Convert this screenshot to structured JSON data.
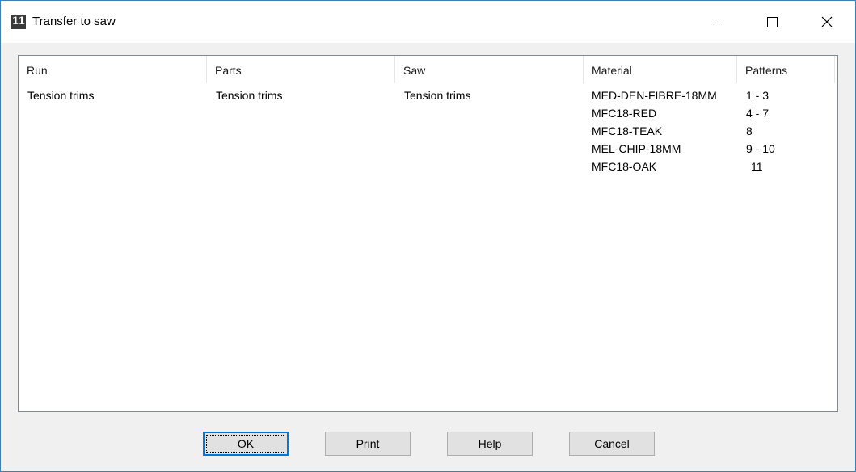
{
  "window": {
    "title": "Transfer to saw",
    "icon": "app-logo-icon",
    "icon_text": "11"
  },
  "columns": [
    "Run",
    "Parts",
    "Saw",
    "Material",
    "Patterns"
  ],
  "rows": [
    {
      "run": "Tension trims",
      "parts": "Tension trims",
      "saw": "Tension trims",
      "material": "MED-DEN-FIBRE-18MM",
      "patterns": "1 - 3"
    },
    {
      "run": "",
      "parts": "",
      "saw": "",
      "material": "MFC18-RED",
      "patterns": "4 - 7"
    },
    {
      "run": "",
      "parts": "",
      "saw": "",
      "material": "MFC18-TEAK",
      "patterns": "8"
    },
    {
      "run": "",
      "parts": "",
      "saw": "",
      "material": "MEL-CHIP-18MM",
      "patterns": "9 - 10"
    },
    {
      "run": "",
      "parts": "",
      "saw": "",
      "material": "MFC18-OAK",
      "patterns": "11"
    }
  ],
  "buttons": {
    "ok": "OK",
    "print": "Print",
    "help": "Help",
    "cancel": "Cancel"
  },
  "colors": {
    "window_border": "#3c7fb1",
    "default_button_border": "#0078d7",
    "dialog_background": "#f0f0f0"
  }
}
